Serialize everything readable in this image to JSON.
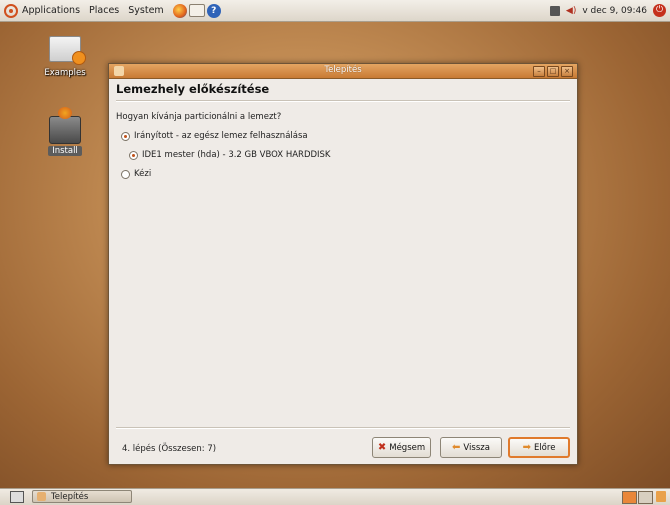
{
  "top_panel": {
    "menus": [
      "Applications",
      "Places",
      "System"
    ],
    "clock": "v dec  9, 09:46",
    "icons": [
      "ubuntu-logo-icon",
      "firefox-icon",
      "mail-icon",
      "help-icon",
      "network-icon",
      "volume-icon",
      "power-icon"
    ]
  },
  "desktop": {
    "icons": [
      {
        "label": "Examples",
        "icon": "folder-icon"
      },
      {
        "label": "Install",
        "icon": "install-icon"
      }
    ]
  },
  "window": {
    "title": "Telepítés",
    "heading": "Lemezhely előkészítése",
    "question": "Hogyan kívánja particionálni a lemezt?",
    "options": [
      {
        "label": "Irányított - az egész lemez felhasználása",
        "checked": true
      },
      {
        "label": "IDE1 mester (hda) - 3.2 GB VBOX HARDDISK",
        "checked": true
      },
      {
        "label": "Kézi",
        "checked": false
      }
    ],
    "step_text": "4. lépés (Összesen: 7)",
    "buttons": {
      "cancel": "Mégsem",
      "back": "Vissza",
      "forward": "Előre"
    }
  },
  "bottom_panel": {
    "task_label": "Telepítés"
  },
  "colors": {
    "accent": "#e07a2c",
    "titlebar": "#c87a34",
    "desktop": "#b07a45"
  }
}
